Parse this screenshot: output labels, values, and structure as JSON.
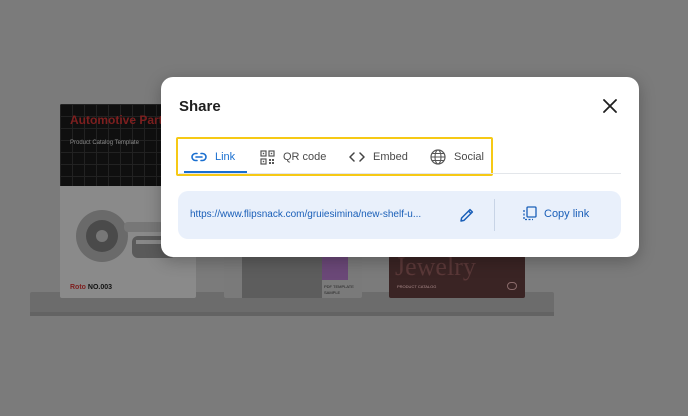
{
  "modal": {
    "title": "Share",
    "tabs": [
      {
        "label": "Link",
        "icon": "link-icon"
      },
      {
        "label": "QR code",
        "icon": "qr-code-icon"
      },
      {
        "label": "Embed",
        "icon": "code-icon"
      },
      {
        "label": "Social",
        "icon": "globe-icon"
      }
    ],
    "active_tab": "Link",
    "url": "https://www.flipsnack.com/gruiesimina/new-shelf-u...",
    "copy_label": "Copy link",
    "accent_color": "#1a6fd0",
    "highlight_color": "#f6c915"
  },
  "background": {
    "books": [
      {
        "title": "Automotive Parts",
        "subtitle": "Product Catalog Template",
        "brand": "Roto",
        "number": "NO.003"
      },
      {
        "label_line1": "PDF TEMPLATE",
        "label_line2": "SAMPLE"
      },
      {
        "title": "Jewelry",
        "subtitle": "PRODUCT CATALOG"
      }
    ]
  }
}
